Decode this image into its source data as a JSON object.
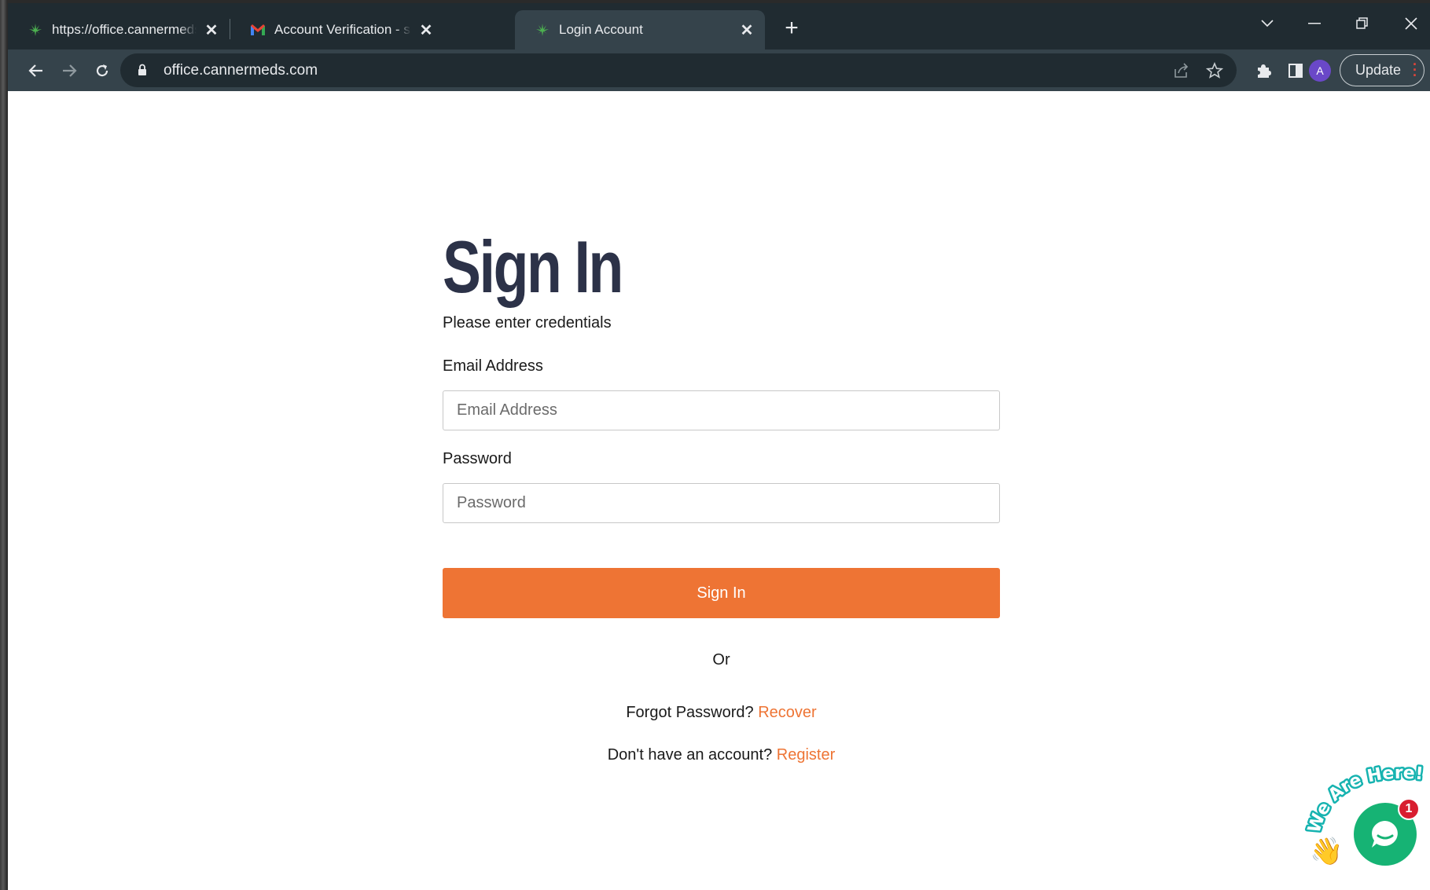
{
  "tabs": [
    {
      "title": "https://office.cannermeds.com/success",
      "favicon": "cannabis-leaf-icon",
      "active": false
    },
    {
      "title": "Account Verification - smithandrew",
      "favicon": "gmail-icon",
      "active": false
    },
    {
      "title": "Login Account",
      "favicon": "cannabis-leaf-icon",
      "active": true
    }
  ],
  "toolbar": {
    "url": "office.cannermeds.com",
    "avatar_letter": "A",
    "update_label": "Update"
  },
  "page": {
    "title": "Sign In",
    "subtitle": "Please enter credentials",
    "email_label": "Email Address",
    "email_placeholder": "Email Address",
    "password_label": "Password",
    "password_placeholder": "Password",
    "signin_button": "Sign In",
    "or_text": "Or",
    "forgot_text": "Forgot Password?",
    "recover_link": "Recover",
    "no_account_text": "Don't have an account?",
    "register_link": "Register"
  },
  "chat_widget": {
    "banner_text": "We Are Here!",
    "badge_count": "1"
  },
  "colors": {
    "accent": "#ee7434",
    "title": "#2c3248",
    "chrome_dark": "#202b31",
    "chrome_toolbar": "#35434b",
    "chat_green": "#16b374",
    "badge_red": "#d81e30"
  }
}
